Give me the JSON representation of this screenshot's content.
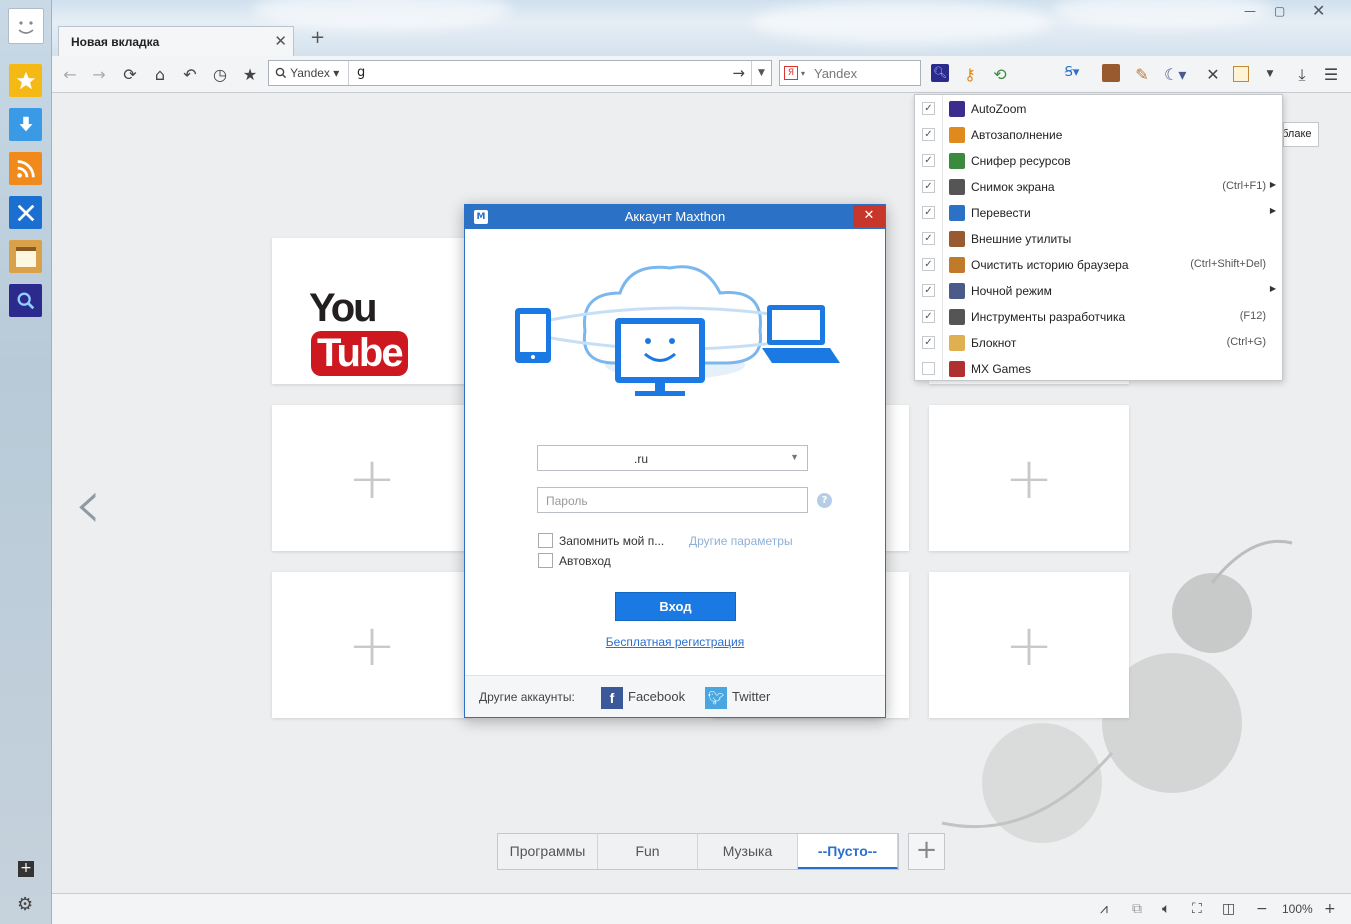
{
  "tab": {
    "title": "Новая вкладка"
  },
  "address": {
    "engine_label": "Yandex",
    "value": "g"
  },
  "search": {
    "engine_label": "Yandex"
  },
  "dialog": {
    "title": "Аккаунт Maxthon",
    "account_value": ".ru",
    "password_placeholder": "Пароль",
    "remember_label": "Запомнить мой п...",
    "other_params": "Другие параметры",
    "autologin_label": "Автовход",
    "login_button": "Вход",
    "register_link": "Бесплатная регистрация",
    "other_accounts": "Другие аккаунты:",
    "facebook": "Facebook",
    "twitter": "Twitter"
  },
  "menu": {
    "items": [
      {
        "label": "AutoZoom",
        "shortcut": "",
        "submenu": false,
        "checked": true,
        "icon": "magnifier-icon",
        "color": "#3a2d8f"
      },
      {
        "label": "Автозаполнение",
        "shortcut": "",
        "submenu": false,
        "checked": true,
        "icon": "key-icon",
        "color": "#e08a1e"
      },
      {
        "label": "Снифер ресурсов",
        "shortcut": "",
        "submenu": false,
        "checked": true,
        "icon": "sniffer-icon",
        "color": "#3b8a3e"
      },
      {
        "label": "Снимок экрана",
        "shortcut": "(Ctrl+F1)",
        "submenu": true,
        "checked": true,
        "icon": "camera-icon",
        "color": "#555555"
      },
      {
        "label": "Перевести",
        "shortcut": "",
        "submenu": true,
        "checked": true,
        "icon": "translate-icon",
        "color": "#2b72c6"
      },
      {
        "label": "Внешние утилиты",
        "shortcut": "",
        "submenu": false,
        "checked": true,
        "icon": "external-tools-icon",
        "color": "#9a5a30"
      },
      {
        "label": "Очистить историю браузера",
        "shortcut": "(Ctrl+Shift+Del)",
        "submenu": false,
        "checked": true,
        "icon": "broom-icon",
        "color": "#c07a2a"
      },
      {
        "label": "Ночной режим",
        "shortcut": "",
        "submenu": true,
        "checked": true,
        "icon": "moon-icon",
        "color": "#4a5a8a"
      },
      {
        "label": "Инструменты разработчика",
        "shortcut": "(F12)",
        "submenu": false,
        "checked": true,
        "icon": "wrench-icon",
        "color": "#555555"
      },
      {
        "label": "Блокнот",
        "shortcut": "(Ctrl+G)",
        "submenu": false,
        "checked": true,
        "icon": "notepad-icon",
        "color": "#e0b050"
      },
      {
        "label": "MX Games",
        "shortcut": "",
        "submenu": false,
        "checked": false,
        "icon": "games-icon",
        "color": "#b03030"
      }
    ]
  },
  "tooltip": {
    "text": "облаке"
  },
  "groups": {
    "items": [
      "Программы",
      "Fun",
      "Музыка",
      "--Пусто--"
    ]
  },
  "tiles": {
    "youtube_you": "You",
    "youtube_tube": "Tube"
  },
  "status": {
    "zoom": "100%"
  }
}
